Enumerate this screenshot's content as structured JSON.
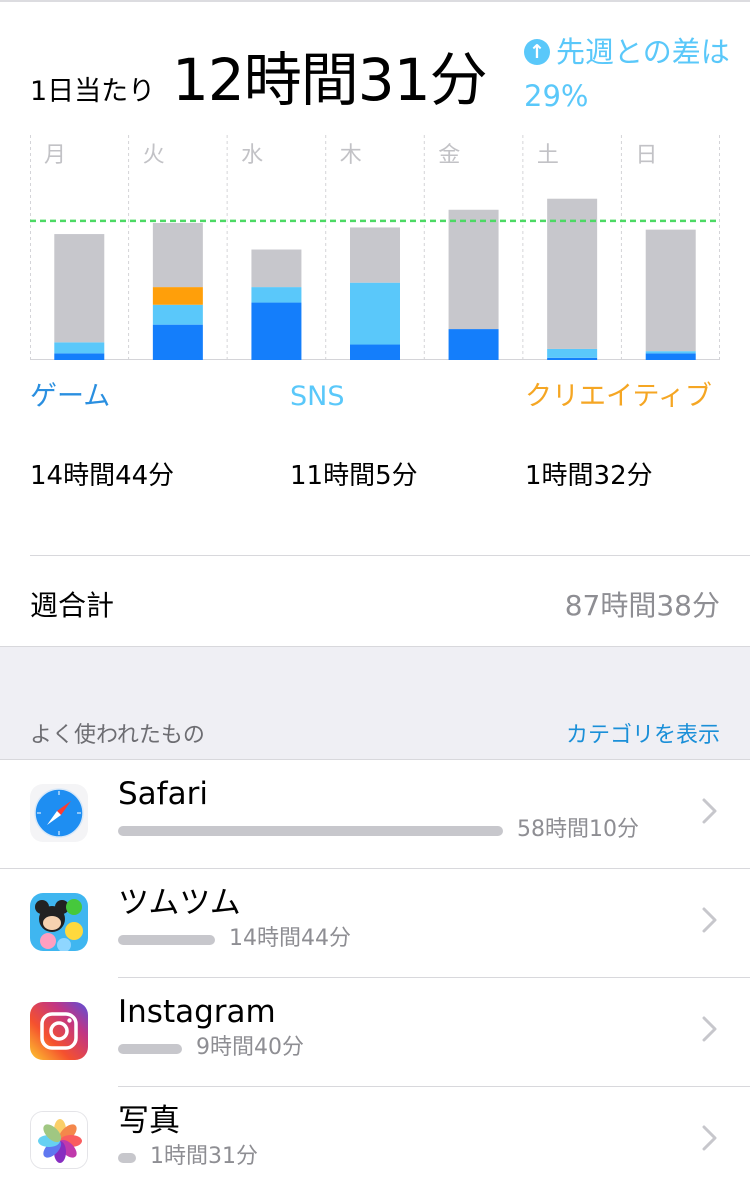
{
  "header": {
    "avg_label": "1日当たり",
    "avg_value": "12時間31分",
    "diff_text": "先週との差は29%",
    "diff_icon": "arrow-up-circle-icon"
  },
  "chart_data": {
    "type": "bar",
    "stacked": true,
    "categories": [
      "月",
      "火",
      "水",
      "木",
      "金",
      "土",
      "日"
    ],
    "series": [
      {
        "name": "ゲーム",
        "color": "#147efb",
        "values": [
          0.3,
          1.6,
          2.6,
          0.7,
          1.4,
          0.1,
          0.3
        ]
      },
      {
        "name": "SNS",
        "color": "#5ac8fa",
        "values": [
          0.5,
          0.9,
          0.7,
          2.8,
          0.0,
          0.4,
          0.1
        ]
      },
      {
        "name": "クリエイティブ",
        "color": "#ff9f0a",
        "values": [
          0,
          0.8,
          0,
          0,
          0,
          0,
          0
        ]
      },
      {
        "name": "その他",
        "color": "#c7c7cc",
        "values": [
          4.9,
          2.9,
          1.7,
          2.5,
          5.4,
          6.8,
          5.5
        ]
      }
    ],
    "average_line": 6.3,
    "ylim": [
      0,
      8.6
    ],
    "grid": true
  },
  "categories": [
    {
      "label": "ゲーム",
      "time": "14時間44分",
      "color": "#2a8fe0"
    },
    {
      "label": "SNS",
      "time": "11時間5分",
      "color": "#5ac8fa"
    },
    {
      "label": "クリエイティブ",
      "time": "1時間32分",
      "color": "#f5a623"
    }
  ],
  "weekly": {
    "label": "週合計",
    "value": "87時間38分"
  },
  "section": {
    "title": "よく使われたもの",
    "action": "カテゴリを表示"
  },
  "apps": [
    {
      "name": "Safari",
      "time": "58時間10分",
      "fraction": 1.0,
      "icon": "safari-icon"
    },
    {
      "name": "ツムツム",
      "time": "14時間44分",
      "fraction": 0.253,
      "icon": "tsumtsum-icon"
    },
    {
      "name": "Instagram",
      "time": "9時間40分",
      "fraction": 0.166,
      "icon": "instagram-icon"
    },
    {
      "name": "写真",
      "time": "1時間31分",
      "fraction": 0.026,
      "icon": "photos-icon"
    }
  ]
}
